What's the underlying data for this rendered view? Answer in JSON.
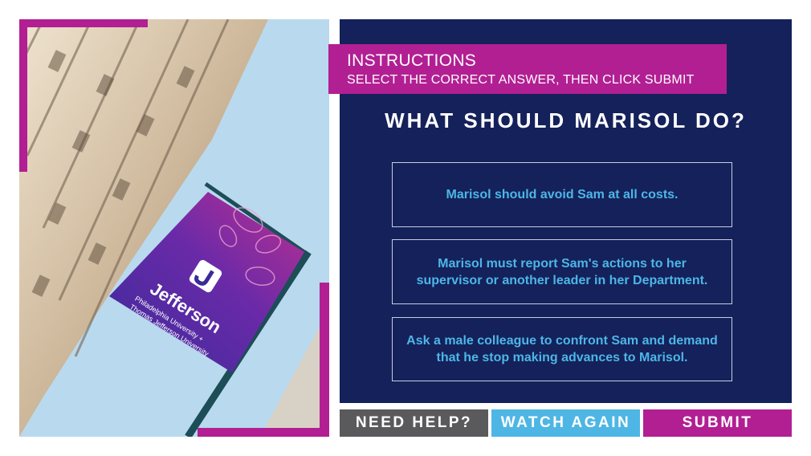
{
  "instructions": {
    "title": "INSTRUCTIONS",
    "subtitle": "SELECT THE CORRECT ANSWER, THEN CLICK SUBMIT"
  },
  "question": "WHAT SHOULD MARISOL DO?",
  "options": [
    {
      "text": "Marisol should avoid Sam at all costs."
    },
    {
      "text": "Marisol must report Sam's actions to her supervisor or another leader in her Department."
    },
    {
      "text": "Ask a male colleague to confront Sam and demand that he stop making advances to Marisol."
    }
  ],
  "photo": {
    "banner_brand": "Jefferson",
    "banner_line1": "Philadelphia University +",
    "banner_line2": "Thomas Jefferson University"
  },
  "buttons": {
    "help": "NEED HELP?",
    "watch_again": "WATCH AGAIN",
    "submit": "SUBMIT"
  },
  "colors": {
    "navy": "#14215a",
    "magenta": "#b21f93",
    "sky_blue": "#4eb6e4",
    "gray": "#5a5a5c",
    "option_text": "#4db6e6"
  }
}
